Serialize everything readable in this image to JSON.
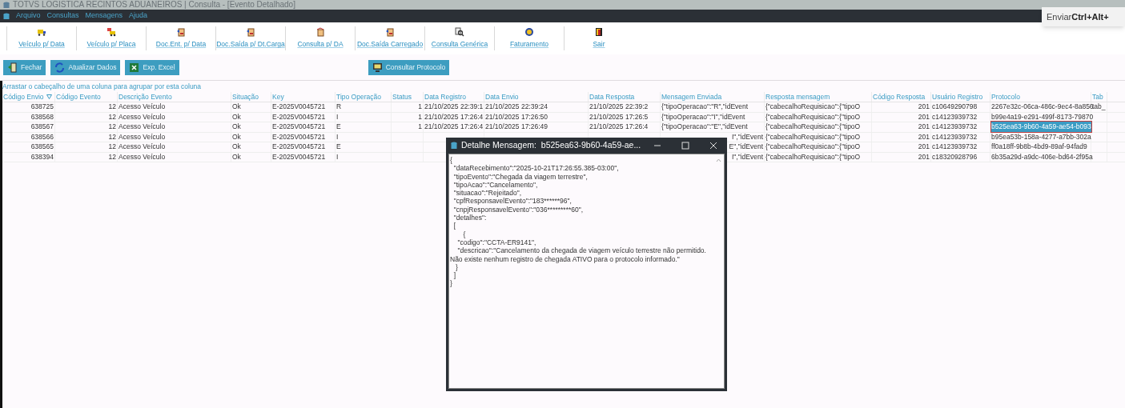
{
  "window": {
    "title": "TOTVS LOGISTICA RECINTOS ADUANEIROS | Consulta - [Evento Detalhado]"
  },
  "menu": [
    "Arquivo",
    "Consultas",
    "Mensagens",
    "Ajuda"
  ],
  "toolbar": [
    "Veículo p/ Data",
    "Veículo p/ Placa",
    "Doc.Ent. p/ Data",
    "Doc.Saída p/ Dt.Carga",
    "Consulta p/ DA",
    "Doc.Saída Carregado",
    "Consulta Genérica",
    "Faturamento",
    "Sair"
  ],
  "actions": [
    {
      "label": "Fechar"
    },
    {
      "label": "Atualizar Dados"
    },
    {
      "label": "Exp. Excel"
    },
    {
      "label": "Consultar Protocolo"
    }
  ],
  "tooltip": {
    "text": "Enviar ",
    "keys": "Ctrl+Alt+"
  },
  "table": {
    "group_hint": "Arrastar o cabeçalho de uma coluna para agrupar por esta coluna",
    "columns": [
      {
        "label": "Código Envio",
        "sorted": true
      },
      {
        "label": "Código Evento"
      },
      {
        "label": "Descrição Evento"
      },
      {
        "label": "Situação"
      },
      {
        "label": "Key"
      },
      {
        "label": "Tipo Operação"
      },
      {
        "label": "Status"
      },
      {
        "label": "Data Registro"
      },
      {
        "label": "Data Envio"
      },
      {
        "label": "Data Resposta"
      },
      {
        "label": "Mensagem Enviada"
      },
      {
        "label": "Resposta mensagem"
      },
      {
        "label": "Código Resposta"
      },
      {
        "label": "Usuário Registro"
      },
      {
        "label": "Protocolo"
      },
      {
        "label": "Tab"
      }
    ],
    "rows": [
      {
        "selected": false,
        "cells": [
          "638725",
          "12",
          "Acesso Veículo",
          "Ok",
          "E-2025V0045721",
          "R",
          "1",
          "21/10/2025 22:39:1",
          "21/10/2025 22:39:24",
          "21/10/2025 22:39:2",
          "{\"tipoOperacao\":\"R\",\"idEvent",
          "{\"cabecalhoRequisicao\":{\"tipoO",
          "201",
          "c10649290798",
          "2267e32c-06ca-486c-9ec4-8a856",
          "tab_"
        ]
      },
      {
        "selected": false,
        "cells": [
          "638568",
          "12",
          "Acesso Veículo",
          "Ok",
          "E-2025V0045721",
          "I",
          "1",
          "21/10/2025 17:26:4",
          "21/10/2025 17:26:50",
          "21/10/2025 17:26:5",
          "{\"tipoOperacao\":\"I\",\"idEvent",
          "{\"cabecalhoRequisicao\":{\"tipoO",
          "201",
          "c14123939732",
          "b99e4a19-e291-499f-8173-79870",
          null
        ]
      },
      {
        "selected": true,
        "cells": [
          "638567",
          "12",
          "Acesso Veículo",
          "Ok",
          "E-2025V0045721",
          "E",
          "1",
          "21/10/2025 17:26:4",
          "21/10/2025 17:26:49",
          "21/10/2025 17:26:4",
          "{\"tipoOperacao\":\"E\",\"idEvent",
          "{\"cabecalhoRequisicao\":{\"tipoO",
          "201",
          "c14123939732",
          "b525ea63-9b60-4a59-ae54-b093",
          null
        ]
      },
      {
        "selected": false,
        "cells": [
          "638566",
          "12",
          "Acesso Veículo",
          "Ok",
          "E-2025V0045721",
          "I",
          null,
          null,
          null,
          null,
          "I\",\"idEvent",
          "{\"cabecalhoRequisicao\":{\"tipoO",
          "201",
          "c14123939732",
          "b95ea53b-158a-4277-a7bb-302a",
          null
        ]
      },
      {
        "selected": false,
        "cells": [
          "638565",
          "12",
          "Acesso Veículo",
          "Ok",
          "E-2025V0045721",
          "E",
          null,
          null,
          null,
          null,
          "E\",\"idEvent",
          "{\"cabecalhoRequisicao\":{\"tipoO",
          "201",
          "c14123939732",
          "ff0a18ff-9b8b-4bd9-89af-94fad9",
          null
        ]
      },
      {
        "selected": false,
        "cells": [
          "638394",
          "12",
          "Acesso Veículo",
          "Ok",
          "E-2025V0045721",
          "I",
          null,
          null,
          null,
          null,
          "I\",\"idEvent",
          "{\"cabecalhoRequisicao\":{\"tipoO",
          "201",
          "c18320928796",
          "6b35a29d-a9dc-406e-bd64-2f95a",
          null
        ]
      }
    ]
  },
  "dialog": {
    "title": "Detalhe Mensagem:  b525ea63-9b60-4a59-ae...",
    "text": "{\n  \"dataRecebimento\":\"2025-10-21T17:26:55.385-03:00\",\n  \"tipoEvento\":\"Chegada da viagem terrestre\",\n  \"tipoAcao\":\"Cancelamento\",\n  \"situacao\":\"Rejeitado\",\n  \"cpfResponsavelEvento\":\"183******96\",\n  \"cnpjResponsavelEvento\":\"036*********60\",\n  \"detalhes\":\n  [\n       {\n    \"codigo\":\"CCTA-ER9141\",\n    \"descricao\":\"Cancelamento da chegada de viagem veículo terrestre não permitido.\nNão existe nenhum registro de chegada ATIVO para o protocolo informado.\"\n   }\n  ]\n}"
  }
}
